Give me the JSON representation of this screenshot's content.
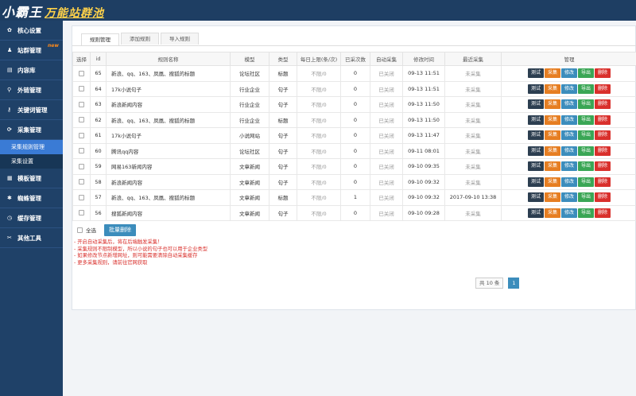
{
  "brand": {
    "title": "小霸王",
    "subtitle": "万能站群池"
  },
  "sidebar": {
    "items": [
      {
        "icon": "gear-icon",
        "glyph": "✿",
        "label": "核心设置"
      },
      {
        "icon": "user-icon",
        "glyph": "♟",
        "label": "站群管理",
        "badge": "new"
      },
      {
        "icon": "book-icon",
        "glyph": "▤",
        "label": "内容库"
      },
      {
        "icon": "link-icon",
        "glyph": "⚲",
        "label": "外链管理"
      },
      {
        "icon": "key-icon",
        "glyph": "⚷",
        "label": "关键词管理"
      },
      {
        "icon": "sync-icon",
        "glyph": "⟳",
        "label": "采集管理"
      }
    ],
    "sub_items": [
      {
        "label": "采集规则管理",
        "active": true
      },
      {
        "label": "采集设置",
        "active": false
      }
    ],
    "items2": [
      {
        "icon": "grid-icon",
        "glyph": "▦",
        "label": "模板管理"
      },
      {
        "icon": "spider-icon",
        "glyph": "✱",
        "label": "蜘蛛管理"
      },
      {
        "icon": "clock-icon",
        "glyph": "◷",
        "label": "缓存管理"
      },
      {
        "icon": "tools-icon",
        "glyph": "✂",
        "label": "其他工具"
      }
    ]
  },
  "tabs": [
    "规则管理",
    "添加规则",
    "导入规则"
  ],
  "table": {
    "headers": [
      "选择",
      "id",
      "规则名称",
      "模型",
      "类型",
      "每日上限(条/次)",
      "已采次数",
      "自动采集",
      "修改时间",
      "最近采集",
      "管理"
    ],
    "rows": [
      {
        "id": "65",
        "name": "新浪、qq、163、凤凰、搜狐的标题",
        "model": "论坛社区",
        "type": "标题",
        "limit": "不限/0",
        "count": "0",
        "auto": "已关闭",
        "mtime": "09-13 11:51",
        "last": "未采集"
      },
      {
        "id": "64",
        "name": "17k小说句子",
        "model": "行业企业",
        "type": "句子",
        "limit": "不限/0",
        "count": "0",
        "auto": "已关闭",
        "mtime": "09-13 11:51",
        "last": "未采集"
      },
      {
        "id": "63",
        "name": "新浪新闻内容",
        "model": "行业企业",
        "type": "句子",
        "limit": "不限/0",
        "count": "0",
        "auto": "已关闭",
        "mtime": "09-13 11:50",
        "last": "未采集"
      },
      {
        "id": "62",
        "name": "新浪、qq、163、凤凰、搜狐的标题",
        "model": "行业企业",
        "type": "标题",
        "limit": "不限/0",
        "count": "0",
        "auto": "已关闭",
        "mtime": "09-13 11:50",
        "last": "未采集"
      },
      {
        "id": "61",
        "name": "17k小说句子",
        "model": "小说网站",
        "type": "句子",
        "limit": "不限/0",
        "count": "0",
        "auto": "已关闭",
        "mtime": "09-13 11:47",
        "last": "未采集"
      },
      {
        "id": "60",
        "name": "腾讯qq内容",
        "model": "论坛社区",
        "type": "句子",
        "limit": "不限/0",
        "count": "0",
        "auto": "已关闭",
        "mtime": "09-11 08:01",
        "last": "未采集"
      },
      {
        "id": "59",
        "name": "网易163新闻内容",
        "model": "文章新闻",
        "type": "句子",
        "limit": "不限/0",
        "count": "0",
        "auto": "已关闭",
        "mtime": "09-10 09:35",
        "last": "未采集"
      },
      {
        "id": "58",
        "name": "新浪新闻内容",
        "model": "文章新闻",
        "type": "句子",
        "limit": "不限/0",
        "count": "0",
        "auto": "已关闭",
        "mtime": "09-10 09:32",
        "last": "未采集"
      },
      {
        "id": "57",
        "name": "新浪、qq、163、凤凰、搜狐的标题",
        "model": "文章新闻",
        "type": "标题",
        "limit": "不限/0",
        "count": "1",
        "auto": "已关闭",
        "mtime": "09-10 09:32",
        "last": "2017-09-10 13:38"
      },
      {
        "id": "56",
        "name": "搜狐新闻内容",
        "model": "文章新闻",
        "type": "句子",
        "limit": "不限/0",
        "count": "0",
        "auto": "已关闭",
        "mtime": "09-10 09:28",
        "last": "未采集"
      }
    ],
    "actions": [
      "测试",
      "采集",
      "修改",
      "导出",
      "删除"
    ]
  },
  "footer": {
    "select_all": "全选",
    "batch_delete": "批量删除"
  },
  "notes": [
    "- 开启自动采集后，将在后端触发采集！",
    "- 采集规则不限制模型，所以小说的句子也可以用于企业类型",
    "- 如果修改节点新增网址，则可能需要清除自动采集缓存",
    "- 更多采集规则，请前往官网获取"
  ],
  "pagination": {
    "total": "共 10 条",
    "current": "1"
  },
  "colors": {
    "sidebar": "#1f4168",
    "topbar": "#1e3e63",
    "active": "#3a7bd5",
    "danger": "#d9302c"
  }
}
